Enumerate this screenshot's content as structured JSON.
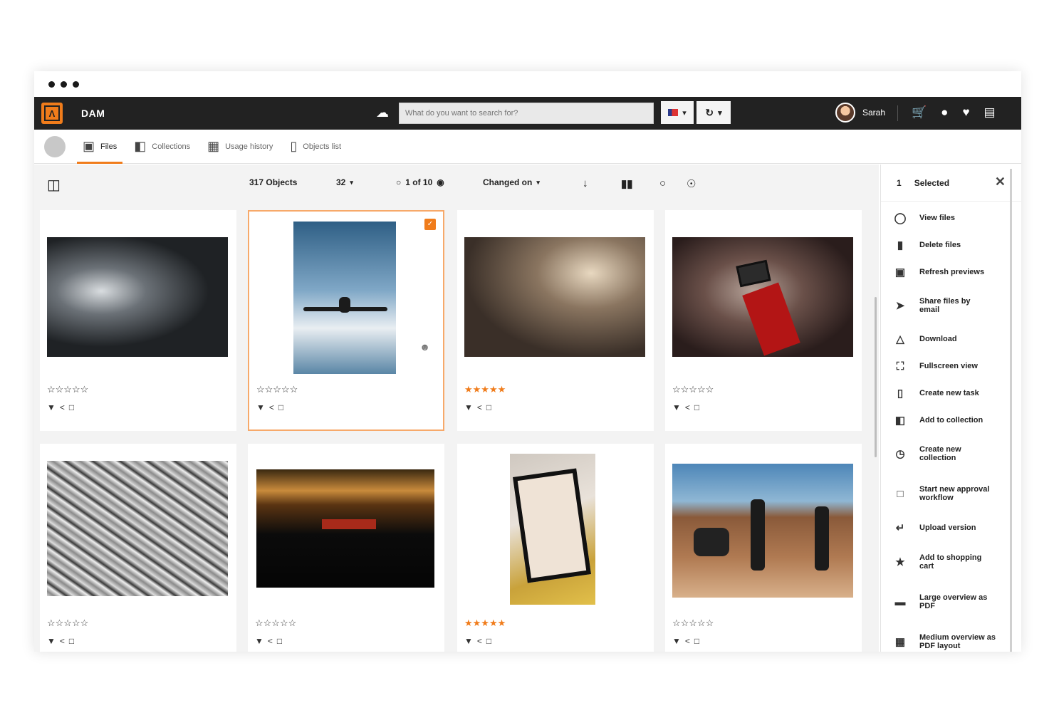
{
  "app": {
    "name": "DAM"
  },
  "search": {
    "placeholder": "What do you want to search for?"
  },
  "user": {
    "name": "Sarah"
  },
  "tabs": [
    {
      "label": "Files",
      "icon": "image-icon"
    },
    {
      "label": "Collections",
      "icon": "collections-icon"
    },
    {
      "label": "Usage history",
      "icon": "history-grid-icon"
    },
    {
      "label": "Objects list",
      "icon": "objects-icon"
    }
  ],
  "toolbar": {
    "objects": "317 Objects",
    "per_page": "32",
    "pagination": "1 of 10",
    "sort": "Changed on"
  },
  "panel": {
    "count": "1",
    "title": "Selected",
    "actions": [
      {
        "label": "View files",
        "icon": "eye-icon"
      },
      {
        "label": "Delete files",
        "icon": "trash-icon"
      },
      {
        "label": "Refresh previews",
        "icon": "refresh-preview-icon"
      },
      {
        "label": "Share files by email",
        "icon": "send-icon"
      },
      {
        "label": "Download",
        "icon": "download-icon"
      },
      {
        "label": "Fullscreen view",
        "icon": "fullscreen-icon"
      },
      {
        "label": "Create new task",
        "icon": "task-icon"
      },
      {
        "label": "Add to collection",
        "icon": "add-collection-icon"
      },
      {
        "label": "Create new collection",
        "icon": "new-collection-icon"
      },
      {
        "label": "Start new approval workflow",
        "icon": "approval-icon"
      },
      {
        "label": "Upload version",
        "icon": "upload-version-icon"
      },
      {
        "label": "Add to shopping cart",
        "icon": "cart-add-icon"
      },
      {
        "label": "Large overview as PDF",
        "icon": "pdf-large-icon"
      },
      {
        "label": "Medium overview as PDF layout",
        "icon": "pdf-medium-icon"
      }
    ]
  },
  "files": [
    {
      "id": "studio-set",
      "rating": 0,
      "selected": false
    },
    {
      "id": "airplane-sky",
      "rating": 0,
      "selected": true
    },
    {
      "id": "warehouse-shoot",
      "rating": 5,
      "selected": false
    },
    {
      "id": "camera-monitor",
      "rating": 0,
      "selected": false
    },
    {
      "id": "comic-sketch",
      "rating": 0,
      "selected": false
    },
    {
      "id": "stage-lights",
      "rating": 0,
      "selected": false
    },
    {
      "id": "portrait-frame",
      "rating": 5,
      "selected": false
    },
    {
      "id": "western-set",
      "rating": 0,
      "selected": false
    }
  ],
  "colors": {
    "accent": "#f07c1b",
    "topbar": "#222222"
  }
}
